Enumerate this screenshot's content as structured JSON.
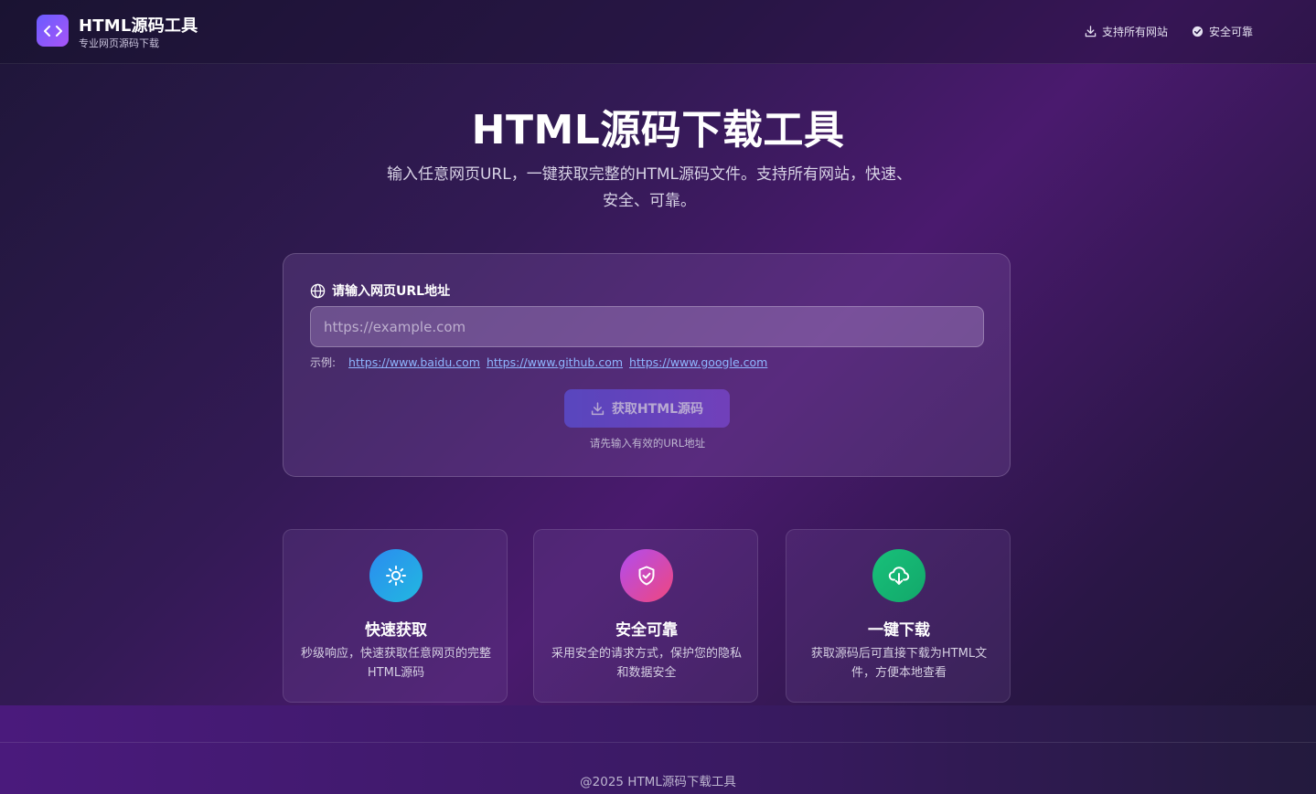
{
  "header": {
    "brand_title": "HTML源码工具",
    "brand_subtitle": "专业网页源码下载",
    "nav": {
      "support_label": "支持所有网站",
      "safe_label": "安全可靠"
    }
  },
  "hero": {
    "title": "HTML源码下载工具",
    "description": "输入任意网页URL，一键获取完整的HTML源码文件。支持所有网站，快速、安全、可靠。"
  },
  "form": {
    "label": "请输入网页URL地址",
    "placeholder": "https://example.com",
    "value": "",
    "examples_label": "示例:",
    "examples": [
      "https://www.baidu.com",
      "https://www.github.com",
      "https://www.google.com"
    ],
    "submit_label": "获取HTML源码",
    "hint": "请先输入有效的URL地址"
  },
  "features": [
    {
      "icon": "sun-icon",
      "title": "快速获取",
      "description": "秒级响应，快速获取任意网页的完整HTML源码"
    },
    {
      "icon": "shield-check-icon",
      "title": "安全可靠",
      "description": "采用安全的请求方式，保护您的隐私和数据安全"
    },
    {
      "icon": "cloud-download-icon",
      "title": "一键下载",
      "description": "获取源码后可直接下载为HTML文件，方便本地查看"
    }
  ],
  "footer": {
    "copyright": "@2025 HTML源码下载工具"
  },
  "colors": {
    "accent": "#6a5cff",
    "link": "#8fb6ff",
    "feature_blue": "#2b8cf0",
    "feature_pink": "#d84bb5",
    "feature_green": "#18c07a"
  }
}
